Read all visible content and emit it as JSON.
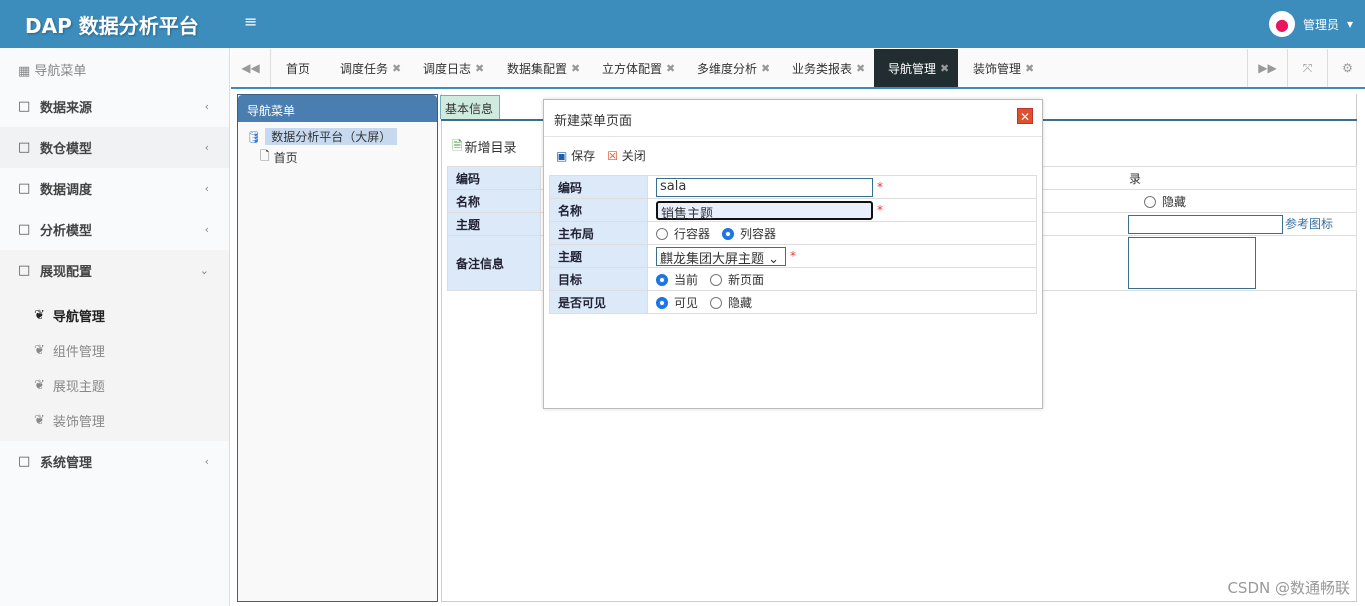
{
  "header": {
    "title": "DAP 数据分析平台",
    "menu_icon": "≡",
    "user": "管理员"
  },
  "sidebar": {
    "title": "导航菜单",
    "items": [
      {
        "label": "数据来源"
      },
      {
        "label": "数仓模型"
      },
      {
        "label": "数据调度"
      },
      {
        "label": "分析模型"
      },
      {
        "label": "展现配置"
      },
      {
        "label": "系统管理"
      }
    ],
    "subitems": [
      {
        "label": "导航管理"
      },
      {
        "label": "组件管理"
      },
      {
        "label": "展现主题"
      },
      {
        "label": "装饰管理"
      }
    ]
  },
  "tabs": [
    {
      "label": "首页"
    },
    {
      "label": "调度任务"
    },
    {
      "label": "调度日志"
    },
    {
      "label": "数据集配置"
    },
    {
      "label": "立方体配置"
    },
    {
      "label": "多维度分析"
    },
    {
      "label": "业务类报表"
    },
    {
      "label": "导航管理"
    },
    {
      "label": "装饰管理"
    }
  ],
  "left_panel": {
    "title": "导航菜单",
    "tree": [
      {
        "label": "数据分析平台（大屏）"
      },
      {
        "label": "首页"
      }
    ]
  },
  "main": {
    "tab": "基本信息",
    "toolbar_add": "新增目录",
    "labels": [
      "编码",
      "名称",
      "主题",
      "备注信息"
    ],
    "partial_text": "录",
    "hide_label": "隐藏",
    "icon_link": "参考图标"
  },
  "dialog": {
    "title": "新建菜单页面",
    "save": "保存",
    "close": "关闭",
    "fields": {
      "code_label": "编码",
      "code_value": "sala",
      "name_label": "名称",
      "name_value": "销售主题",
      "layout_label": "主布局",
      "layout_opts": [
        "行容器",
        "列容器"
      ],
      "layout_selected": "列容器",
      "theme_label": "主题",
      "theme_value": "麒龙集团大屏主题",
      "target_label": "目标",
      "target_opts": [
        "当前",
        "新页面"
      ],
      "target_selected": "当前",
      "visible_label": "是否可见",
      "visible_opts": [
        "可见",
        "隐藏"
      ],
      "visible_selected": "可见"
    }
  },
  "watermark": "CSDN @数通畅联"
}
